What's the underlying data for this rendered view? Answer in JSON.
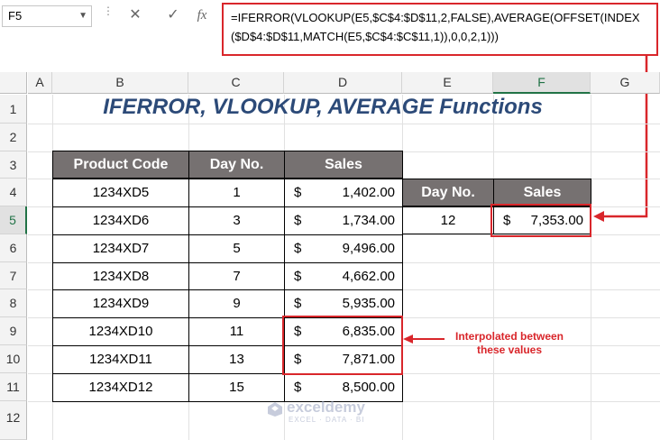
{
  "formula_bar": {
    "name_box": "F5",
    "cancel_icon": "✕",
    "enter_icon": "✓",
    "fx_icon": "fx",
    "formula": "=IFERROR(VLOOKUP(E5,$C$4:$D$11,2,FALSE),AVERAGE(OFFSET(INDEX($D$4:$D$11,MATCH(E5,$C$4:$C$11,1)),0,0,2,1)))"
  },
  "columns": [
    "A",
    "B",
    "C",
    "D",
    "E",
    "F",
    "G"
  ],
  "rows": [
    "1",
    "2",
    "3",
    "4",
    "5",
    "6",
    "7",
    "8",
    "9",
    "10",
    "11",
    "12"
  ],
  "selected_column": "F",
  "selected_row": "5",
  "title": "IFERROR, VLOOKUP, AVERAGE Functions",
  "main_table": {
    "headers": [
      "Product Code",
      "Day No.",
      "Sales"
    ],
    "rows": [
      {
        "code": "1234XD5",
        "day": "1",
        "cur": "$",
        "sales": "1,402.00"
      },
      {
        "code": "1234XD6",
        "day": "3",
        "cur": "$",
        "sales": "1,734.00"
      },
      {
        "code": "1234XD7",
        "day": "5",
        "cur": "$",
        "sales": "9,496.00"
      },
      {
        "code": "1234XD8",
        "day": "7",
        "cur": "$",
        "sales": "4,662.00"
      },
      {
        "code": "1234XD9",
        "day": "9",
        "cur": "$",
        "sales": "5,935.00"
      },
      {
        "code": "1234XD10",
        "day": "11",
        "cur": "$",
        "sales": "6,835.00"
      },
      {
        "code": "1234XD11",
        "day": "13",
        "cur": "$",
        "sales": "7,871.00"
      },
      {
        "code": "1234XD12",
        "day": "15",
        "cur": "$",
        "sales": "8,500.00"
      }
    ]
  },
  "lookup_table": {
    "headers": [
      "Day No.",
      "Sales"
    ],
    "day": "12",
    "cur": "$",
    "sales": "7,353.00"
  },
  "annotation": {
    "line1": "Interpolated between",
    "line2": "these values"
  },
  "watermark": {
    "name": "exceldemy",
    "tagline": "EXCEL · DATA · BI"
  },
  "colors": {
    "header_bg": "#767171",
    "title": "#2c4a78",
    "highlight": "#d9262b",
    "excel_green": "#217346"
  }
}
